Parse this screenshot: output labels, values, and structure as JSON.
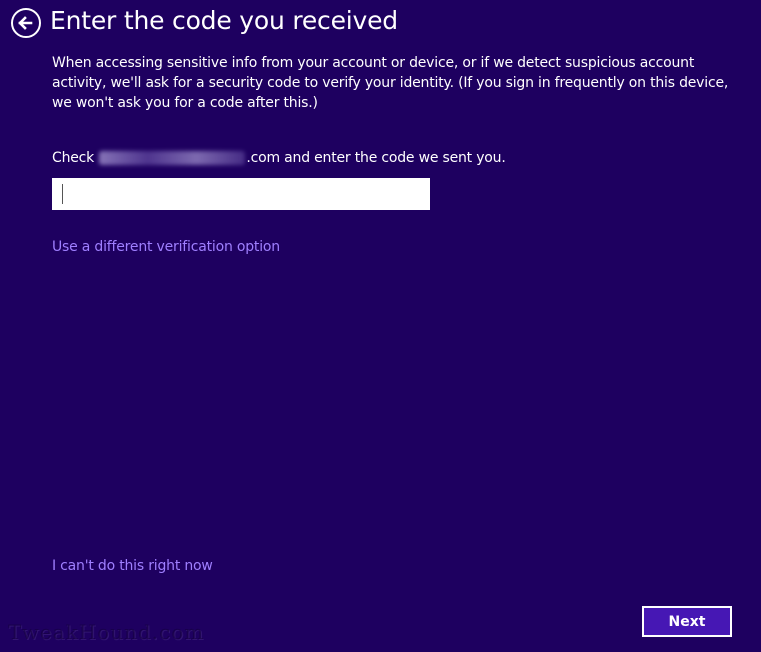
{
  "header": {
    "back_icon": "back-arrow-icon",
    "title": "Enter the code you received"
  },
  "main": {
    "description": "When accessing sensitive info from your account or device, or if we detect suspicious account activity, we'll ask for a security code to verify your identity. (If you sign in frequently on this device, we won't ask you for a code after this.)",
    "check_prefix": "Check",
    "check_suffix": ".com and enter the code we sent you.",
    "code_input_value": "",
    "alt_option_link": "Use a different verification option"
  },
  "footer": {
    "skip_link": "I can't do this right now",
    "next_label": "Next",
    "watermark": "TweakHound.com"
  },
  "colors": {
    "background": "#1e0060",
    "link": "#9f7fff",
    "button": "#4617b4"
  }
}
